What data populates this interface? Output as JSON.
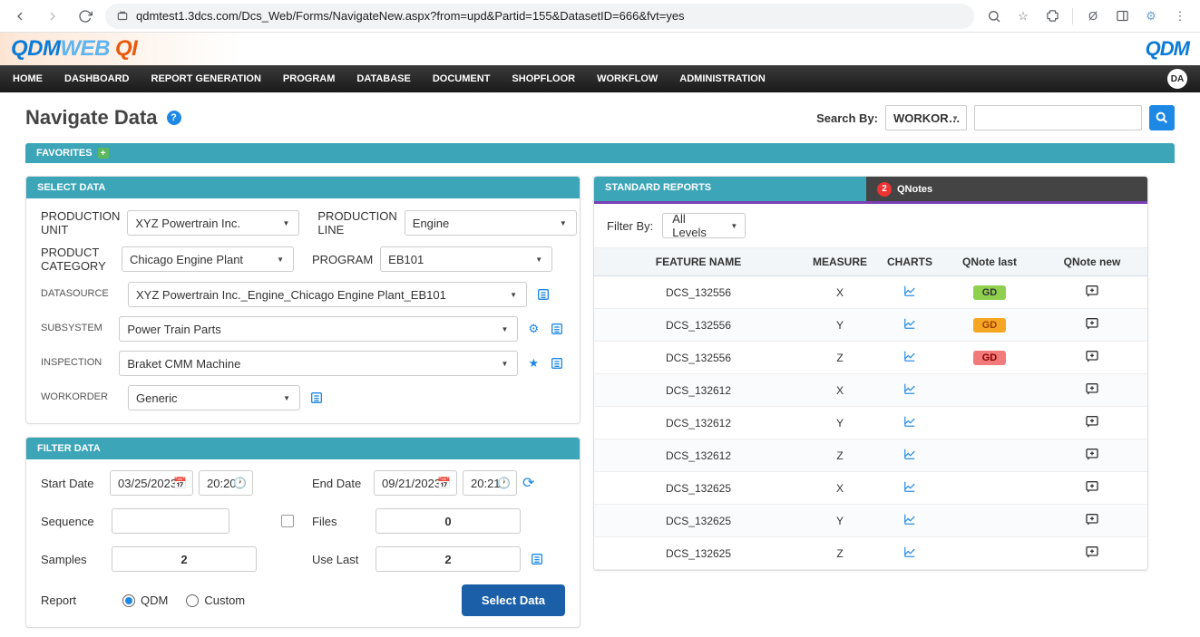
{
  "browser": {
    "url": "qdmtest1.3dcs.com/Dcs_Web/Forms/NavigateNew.aspx?from=upd&Partid=155&DatasetID=666&fvt=yes"
  },
  "logo": {
    "qdm": "QDM",
    "web": "WEB",
    "qi": "QI",
    "right": "QDM"
  },
  "nav": {
    "items": [
      "HOME",
      "DASHBOARD",
      "REPORT GENERATION",
      "PROGRAM",
      "DATABASE",
      "DOCUMENT",
      "SHOPFLOOR",
      "WORKFLOW",
      "ADMINISTRATION"
    ],
    "user_initials": "DA"
  },
  "page": {
    "title": "Navigate Data",
    "search_by_label": "Search By:",
    "search_select": "WORKOR…"
  },
  "favorites": {
    "label": "FAVORITES"
  },
  "select_data": {
    "title": "SELECT DATA",
    "production_unit_label": "PRODUCTION UNIT",
    "production_unit": "XYZ Powertrain Inc.",
    "production_line_label": "PRODUCTION LINE",
    "production_line": "Engine",
    "product_category_label": "PRODUCT CATEGORY",
    "product_category": "Chicago Engine Plant",
    "program_label": "PROGRAM",
    "program": "EB101",
    "datasource_label": "DATASOURCE",
    "datasource": "XYZ Powertrain Inc._Engine_Chicago Engine Plant_EB101",
    "subsystem_label": "SUBSYSTEM",
    "subsystem": "Power Train Parts",
    "inspection_label": "INSPECTION",
    "inspection": "Braket CMM Machine",
    "workorder_label": "WORKORDER",
    "workorder": "Generic"
  },
  "filter_data": {
    "title": "FILTER DATA",
    "start_date_label": "Start Date",
    "start_date": "03/25/2023",
    "start_time": "20:20",
    "end_date_label": "End Date",
    "end_date": "09/21/2023",
    "end_time": "20:21",
    "sequence_label": "Sequence",
    "files_label": "Files",
    "files": "0",
    "samples_label": "Samples",
    "samples": "2",
    "use_last_label": "Use Last",
    "use_last": "2",
    "report_label": "Report",
    "report_qdm": "QDM",
    "report_custom": "Custom",
    "select_data_btn": "Select Data"
  },
  "standard": {
    "title": "STANDARD REPORTS",
    "qnotes": "QNotes",
    "notification_count": "2",
    "filter_by_label": "Filter By:",
    "filter_sel": "All Levels",
    "columns": [
      "FEATURE NAME",
      "MEASURE",
      "CHARTS",
      "QNote last",
      "QNote new"
    ],
    "rows": [
      {
        "feature": "DCS_132556",
        "measure": "X",
        "qlast": "GD",
        "qlast_color": "green"
      },
      {
        "feature": "DCS_132556",
        "measure": "Y",
        "qlast": "GD",
        "qlast_color": "orange"
      },
      {
        "feature": "DCS_132556",
        "measure": "Z",
        "qlast": "GD",
        "qlast_color": "red"
      },
      {
        "feature": "DCS_132612",
        "measure": "X",
        "qlast": "",
        "qlast_color": ""
      },
      {
        "feature": "DCS_132612",
        "measure": "Y",
        "qlast": "",
        "qlast_color": ""
      },
      {
        "feature": "DCS_132612",
        "measure": "Z",
        "qlast": "",
        "qlast_color": ""
      },
      {
        "feature": "DCS_132625",
        "measure": "X",
        "qlast": "",
        "qlast_color": ""
      },
      {
        "feature": "DCS_132625",
        "measure": "Y",
        "qlast": "",
        "qlast_color": ""
      },
      {
        "feature": "DCS_132625",
        "measure": "Z",
        "qlast": "",
        "qlast_color": ""
      }
    ]
  }
}
